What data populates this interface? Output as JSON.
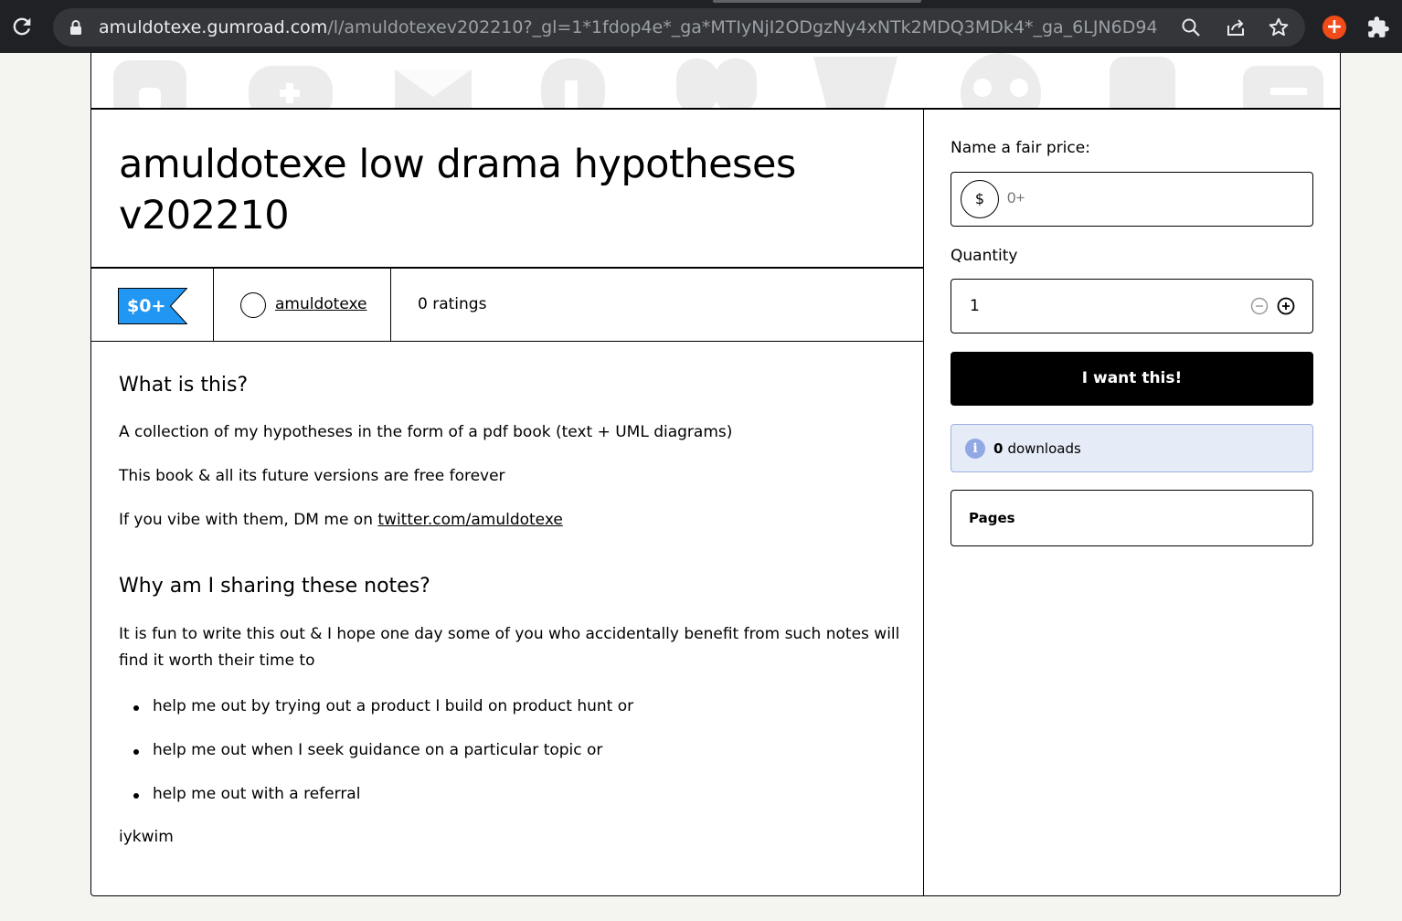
{
  "browser": {
    "url_host": "amuldotexe.gumroad.com",
    "url_path": "/l/amuldotexev202210?_gl=1*1fdop4e*_ga*MTIyNjI2ODgzNy4xNTk2MDQ3MDk4*_ga_6LJN6D94..."
  },
  "product": {
    "title": "amuldotexe low drama hypotheses v202210",
    "price_tag": "$0+",
    "author": "amuldotexe",
    "ratings": "0 ratings"
  },
  "description": {
    "heading1": "What is this?",
    "para1": "A collection of my hypotheses in the form of a pdf book (text + UML diagrams)",
    "para2": "This book & all its future versions are free forever",
    "para3_prefix": "If you vibe with them, DM me on ",
    "para3_link": "twitter.com/amuldotexe",
    "heading2": "Why am I sharing these notes?",
    "para4": "It is fun to write this out & I hope one day some of you who accidentally benefit from such notes will find it worth their time to",
    "bullets": [
      "help me out by trying out a product I build on product hunt or",
      "help me out when I seek guidance on a particular topic or",
      "help me out with a referral"
    ],
    "para5": "iykwim"
  },
  "purchase": {
    "price_label": "Name a fair price:",
    "currency": "$",
    "price_placeholder": "0+",
    "quantity_label": "Quantity",
    "quantity": "1",
    "buy_label": "I want this!",
    "downloads_count": "0",
    "downloads_label": "downloads",
    "pages_label": "Pages"
  },
  "colors": {
    "price_tag_bg": "#2196f3",
    "buy_button_bg": "#000000",
    "info_box_bg": "#e6ebf8",
    "info_icon_bg": "#90a8e4"
  }
}
